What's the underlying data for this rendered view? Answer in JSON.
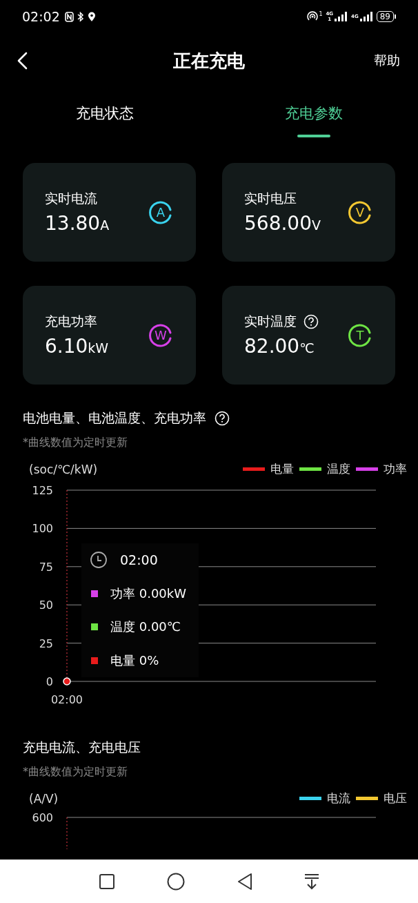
{
  "status_bar": {
    "time": "02:02",
    "hotspot_badge": "1",
    "signals": [
      {
        "label": "4G",
        "sim": "1"
      },
      {
        "label": "4G"
      }
    ],
    "battery": "89"
  },
  "header": {
    "title": "正在充电",
    "help": "帮助"
  },
  "tabs": [
    {
      "label": "充电状态",
      "selected": false
    },
    {
      "label": "充电参数",
      "selected": true
    }
  ],
  "cards": [
    {
      "label": "实时电流",
      "value": "13.80",
      "unit": "A",
      "icon_letter": "A",
      "color": "#3ad3ee",
      "help": false
    },
    {
      "label": "实时电压",
      "value": "568.00",
      "unit": "V",
      "icon_letter": "V",
      "color": "#f2c731",
      "help": false
    },
    {
      "label": "充电功率",
      "value": "6.10",
      "unit": "kW",
      "icon_letter": "W",
      "color": "#d640e8",
      "help": false
    },
    {
      "label": "实时温度",
      "value": "82.00",
      "unit": "℃",
      "icon_letter": "T",
      "color": "#6ee444",
      "help": true
    }
  ],
  "battery_chart": {
    "title": "电池电量、电池温度、充电功率",
    "note": "*曲线数值为定时更新",
    "tooltip": {
      "time": "02:00",
      "rows": [
        {
          "text": "功率 0.00kW",
          "color": "#d640e8"
        },
        {
          "text": "温度 0.00℃",
          "color": "#6ee444"
        },
        {
          "text": "电量 0%",
          "color": "#e81c1c"
        }
      ]
    },
    "ylabel": "(soc/℃/kW)",
    "yticks": [
      "125",
      "100",
      "75",
      "50",
      "25",
      "0"
    ],
    "xtick": "02:00",
    "legend": [
      {
        "name": "电量",
        "color": "#e81c1c"
      },
      {
        "name": "温度",
        "color": "#6ee444"
      },
      {
        "name": "功率",
        "color": "#d640e8"
      }
    ]
  },
  "current_chart": {
    "title": "充电电流、充电电压",
    "note": "*曲线数值为定时更新",
    "ylabel": "(A/V)",
    "legend": [
      {
        "name": "电流",
        "color": "#3ad3ee"
      },
      {
        "name": "电压",
        "color": "#f2c731"
      }
    ],
    "ytick": "600"
  }
}
